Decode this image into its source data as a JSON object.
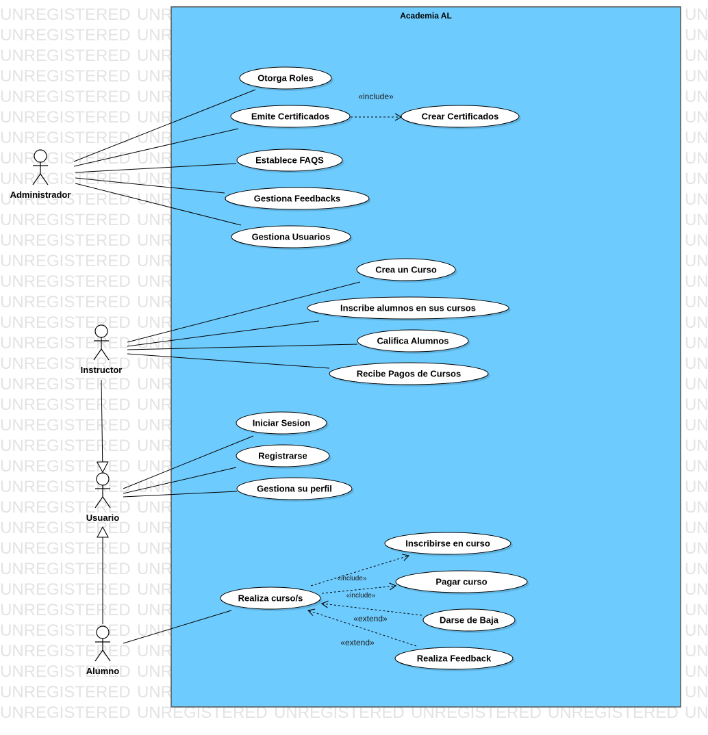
{
  "watermark": "UNREGISTERED",
  "system": {
    "title": "Academia AL",
    "fill": "#6ecbfd",
    "stroke": "#555555"
  },
  "actors": [
    {
      "id": "admin",
      "label": "Administrador"
    },
    {
      "id": "instructor",
      "label": "Instructor"
    },
    {
      "id": "usuario",
      "label": "Usuario"
    },
    {
      "id": "alumno",
      "label": "Alumno"
    }
  ],
  "use_cases": [
    {
      "id": "otorga",
      "label": "Otorga Roles"
    },
    {
      "id": "emite",
      "label": "Emite Certificados"
    },
    {
      "id": "crearcert",
      "label": "Crear Certificados"
    },
    {
      "id": "faqs",
      "label": "Establece FAQS"
    },
    {
      "id": "feedbacks",
      "label": "Gestiona Feedbacks"
    },
    {
      "id": "usuarios",
      "label": "Gestiona Usuarios"
    },
    {
      "id": "creacurso",
      "label": "Crea un Curso"
    },
    {
      "id": "inscribe",
      "label": "Inscribe alumnos en sus cursos"
    },
    {
      "id": "califica",
      "label": "Califica Alumnos"
    },
    {
      "id": "pagos",
      "label": "Recibe Pagos de Cursos"
    },
    {
      "id": "sesion",
      "label": "Iniciar Sesion"
    },
    {
      "id": "registrarse",
      "label": "Registrarse"
    },
    {
      "id": "perfil",
      "label": "Gestiona su perfil"
    },
    {
      "id": "inscribirse",
      "label": "Inscribirse en curso"
    },
    {
      "id": "pagar",
      "label": "Pagar curso"
    },
    {
      "id": "realiza",
      "label": "Realiza curso/s"
    },
    {
      "id": "baja",
      "label": "Darse de Baja"
    },
    {
      "id": "feedback",
      "label": "Realiza  Feedback"
    }
  ],
  "associations": [
    {
      "actor": "admin",
      "use_case": "otorga"
    },
    {
      "actor": "admin",
      "use_case": "emite"
    },
    {
      "actor": "admin",
      "use_case": "faqs"
    },
    {
      "actor": "admin",
      "use_case": "feedbacks"
    },
    {
      "actor": "admin",
      "use_case": "usuarios"
    },
    {
      "actor": "instructor",
      "use_case": "creacurso"
    },
    {
      "actor": "instructor",
      "use_case": "inscribe"
    },
    {
      "actor": "instructor",
      "use_case": "califica"
    },
    {
      "actor": "instructor",
      "use_case": "pagos"
    },
    {
      "actor": "usuario",
      "use_case": "sesion"
    },
    {
      "actor": "usuario",
      "use_case": "registrarse"
    },
    {
      "actor": "usuario",
      "use_case": "perfil"
    },
    {
      "actor": "alumno",
      "use_case": "realiza"
    }
  ],
  "generalizations": [
    {
      "from": "instructor",
      "to": "usuario"
    },
    {
      "from": "alumno",
      "to": "usuario"
    }
  ],
  "dependencies": [
    {
      "from": "emite",
      "to": "crearcert",
      "label": "«include»"
    },
    {
      "from": "realiza",
      "to": "inscribirse",
      "label": "«include»"
    },
    {
      "from": "realiza",
      "to": "pagar",
      "label": "«include»"
    },
    {
      "from": "baja",
      "to": "realiza",
      "label": "«extend»"
    },
    {
      "from": "feedback",
      "to": "realiza",
      "label": "«extend»"
    }
  ]
}
